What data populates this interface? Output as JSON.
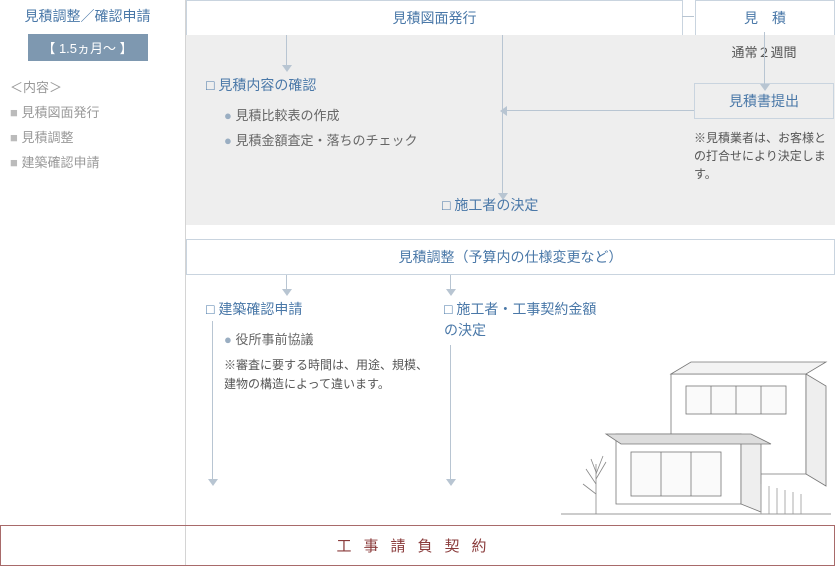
{
  "sidebar": {
    "title": "見積調整／確認申請",
    "badge": "【 1.5ヵ月～ 】",
    "heading": "＜内容＞",
    "items": [
      "見積図面発行",
      "見積調整",
      "建築確認申請"
    ]
  },
  "top": {
    "left_box": "見積図面発行",
    "right_box": "見積"
  },
  "right": {
    "duration": "通常２週間",
    "submit_box": "見積書提出",
    "note": "※見積業者は、お客様との打合せにより決定します。"
  },
  "gray": {
    "title": "見積内容の確認",
    "bullets": [
      "見積比較表の作成",
      "見積金額査定・落ちのチェック"
    ],
    "decision": "施工者の決定"
  },
  "mid_box": "見積調整（予算内の仕様変更など）",
  "lower": {
    "left_title": "建築確認申請",
    "left_bullets": [
      "役所事前協議"
    ],
    "left_note": "※審査に要する時間は、用途、規模、建物の構造によって違います。",
    "right_title": "施工者・工事契約金額の決定"
  },
  "footer": "工事請負契約"
}
